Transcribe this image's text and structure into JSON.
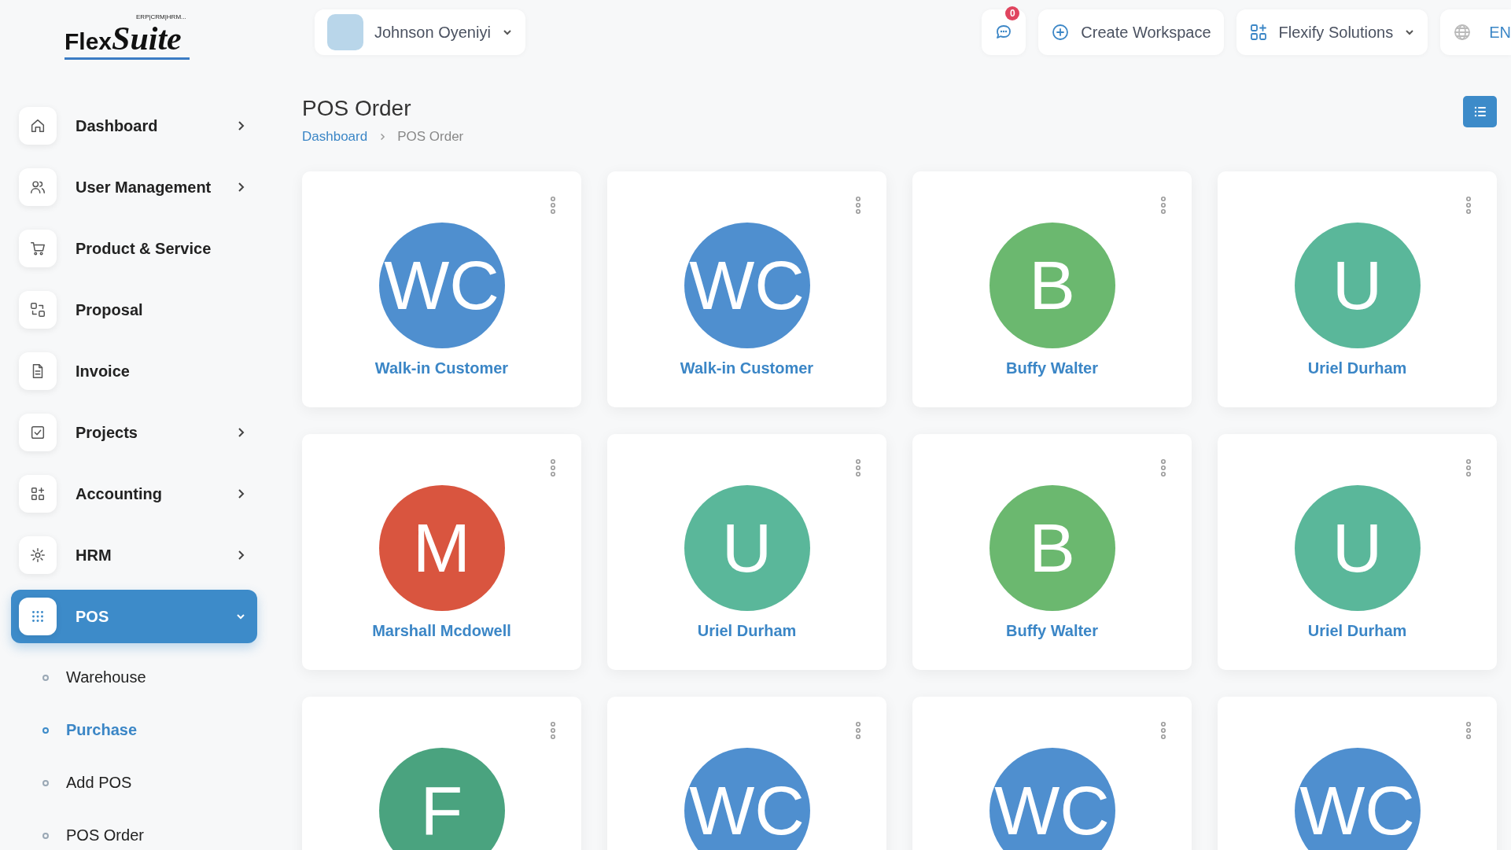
{
  "logo": {
    "word_1": "Flex",
    "word_2": "Suite",
    "tagline": "ERP|CRM|HRM..."
  },
  "sidebar": {
    "items": [
      {
        "label": "Dashboard",
        "kind": "menu",
        "expanded": false,
        "selected": false
      },
      {
        "label": "User Management",
        "kind": "menu",
        "expanded": false,
        "selected": false
      },
      {
        "label": "Product & Service",
        "kind": "link",
        "selected": false
      },
      {
        "label": "Proposal",
        "kind": "link",
        "selected": false
      },
      {
        "label": "Invoice",
        "kind": "link",
        "selected": false
      },
      {
        "label": "Projects",
        "kind": "menu",
        "expanded": false,
        "selected": false
      },
      {
        "label": "Accounting",
        "kind": "menu",
        "expanded": false,
        "selected": false
      },
      {
        "label": "HRM",
        "kind": "menu",
        "expanded": false,
        "selected": false
      },
      {
        "label": "POS",
        "kind": "menu",
        "expanded": true,
        "selected": true,
        "children": [
          {
            "label": "Warehouse",
            "selected": false
          },
          {
            "label": "Purchase",
            "selected": true
          },
          {
            "label": "Add POS",
            "selected": false
          },
          {
            "label": "POS Order",
            "selected": false
          }
        ]
      }
    ]
  },
  "header": {
    "user": "Johnson Oyeniyi",
    "notifications": "0",
    "create_button": "Create Workspace",
    "workspace": "Flexify Solutions",
    "language": "EN"
  },
  "page": {
    "title": "POS Order",
    "breadcrumb": [
      {
        "label": "Dashboard",
        "kind": "link"
      },
      {
        "label": "POS Order",
        "kind": "current"
      }
    ]
  },
  "customers": [
    {
      "initials": "WC",
      "name": "Walk-in Customer",
      "color": "#4f8fcf"
    },
    {
      "initials": "WC",
      "name": "Walk-in Customer",
      "color": "#4f8fcf"
    },
    {
      "initials": "B",
      "name": "Buffy Walter",
      "color": "#6bb86f"
    },
    {
      "initials": "U",
      "name": "Uriel Durham",
      "color": "#5ab79a"
    },
    {
      "initials": "M",
      "name": "Marshall Mcdowell",
      "color": "#d9553f"
    },
    {
      "initials": "U",
      "name": "Uriel Durham",
      "color": "#5ab79a"
    },
    {
      "initials": "B",
      "name": "Buffy Walter",
      "color": "#6bb86f"
    },
    {
      "initials": "U",
      "name": "Uriel Durham",
      "color": "#5ab79a"
    },
    {
      "initials": "F",
      "color": "#4aa37f"
    },
    {
      "initials": "WC",
      "color": "#4f8fcf"
    },
    {
      "initials": "WC",
      "color": "#4f8fcf"
    },
    {
      "initials": "WC",
      "color": "#4f8fcf"
    }
  ]
}
